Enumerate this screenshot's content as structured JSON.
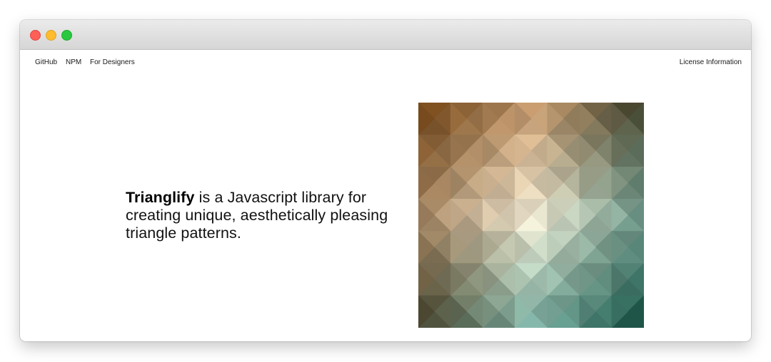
{
  "nav": {
    "github": "GitHub",
    "npm": "NPM",
    "designers": "For Designers",
    "license": "License Information"
  },
  "hero": {
    "brand": "Trianglify",
    "tagline": " is a Javascript library for creating unique, aesthetically pleasing triangle patterns."
  },
  "pattern": {
    "grid": 7,
    "colors": {
      "top_left": "#6b3d0e",
      "top_mid": "#c89a6c",
      "top_right": "#3c3d28",
      "center": "#f7efd8",
      "mid_left": "#a3825d",
      "mid_right": "#6d9a8c",
      "bottom_left": "#3f3c26",
      "bottom_mid": "#7fb5a8",
      "bottom_right": "#0e4a3e"
    }
  }
}
